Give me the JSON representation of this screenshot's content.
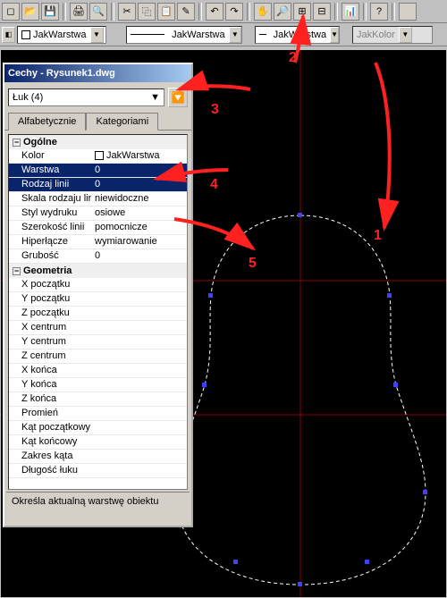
{
  "toolbar": {
    "buttons": [
      "new",
      "open",
      "save",
      "print",
      "preview",
      "cut",
      "copy",
      "paste",
      "match",
      "undo",
      "redo",
      "pan",
      "zoomrt",
      "zoomwin",
      "zoomprev",
      "properties",
      "help",
      "blank"
    ],
    "layer_swatch": "JakWarstwa",
    "linetype": "JakWarstwa",
    "lineweight": "JakWarstwa",
    "plotstyle": "JakKolor"
  },
  "panel": {
    "title": "Cechy - Rysunek1.dwg",
    "object_select": "Łuk (4)",
    "tabs": [
      "Alfabetycznie",
      "Kategoriami"
    ],
    "active_tab": 1,
    "cat_general": "Ogólne",
    "cat_geometry": "Geometria",
    "rows": {
      "kolor_name": "Kolor",
      "kolor_val": "JakWarstwa",
      "warstwa_name": "Warstwa",
      "warstwa_val": "0",
      "rodzajlinii_name": "Rodzaj linii",
      "rodzajlinii_val": "0",
      "skala_name": "Skala rodzaju linii",
      "skala_val": "niewidoczne",
      "styl_name": "Styl wydruku",
      "styl_val": "osiowe",
      "szer_name": "Szerokość linii",
      "szer_val": "pomocnicze",
      "hiper_name": "Hiperłącze",
      "hiper_val": "wymiarowanie",
      "grub_name": "Grubość",
      "grub_val": "0",
      "xp_name": "X początku",
      "xp_val": "",
      "yp_name": "Y początku",
      "yp_val": "",
      "zp_name": "Z początku",
      "zp_val": "",
      "xc_name": "X centrum",
      "xc_val": "",
      "yc_name": "Y centrum",
      "yc_val": "",
      "zc_name": "Z centrum",
      "zc_val": "",
      "xk_name": "X końca",
      "xk_val": "",
      "yk_name": "Y końca",
      "yk_val": "",
      "zk_name": "Z końca",
      "zk_val": "",
      "pr_name": "Promień",
      "pr_val": "",
      "kp_name": "Kąt początkowy",
      "kp_val": "",
      "kk_name": "Kąt końcowy",
      "kk_val": "",
      "zk2_name": "Zakres kąta",
      "zk2_val": "",
      "dl_name": "Długość łuku",
      "dl_val": ""
    },
    "description": "Określa aktualną warstwę obiektu"
  },
  "annotations": {
    "a1": "1",
    "a2": "2",
    "a3": "3",
    "a4": "4",
    "a5": "5"
  }
}
